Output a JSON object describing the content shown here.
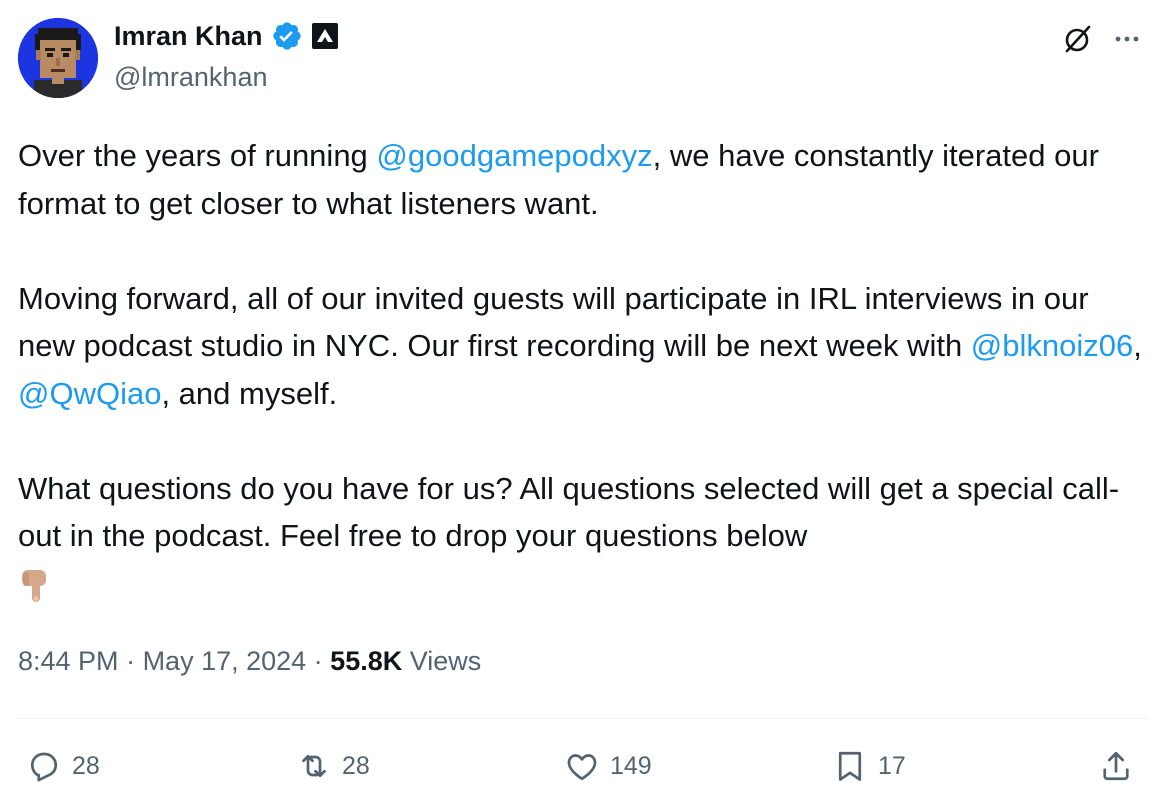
{
  "author": {
    "display_name": "Imran Khan",
    "handle": "@lmrankhan",
    "avatar_bg": "#1d35e0",
    "verified_color": "#1d9bf0",
    "icons": [
      "verified-badge-icon",
      "affiliation-badge-icon"
    ]
  },
  "header_actions": {
    "icons": [
      "grok-icon",
      "more-icon"
    ]
  },
  "tweet": {
    "p1": {
      "a": "Over the years of running ",
      "mention": "@goodgamepodxyz",
      "b": ", we have constantly iterated our format to get closer to what listeners want."
    },
    "p2": {
      "a": "Moving forward, all of our invited guests will participate in IRL interviews in our new podcast studio in NYC. Our first recording will be next week with ",
      "mention1": "@blknoiz06",
      "sep": ", ",
      "mention2": "@QwQiao",
      "b": ", and myself."
    },
    "p3": {
      "a": "What questions do you have for us? All questions selected will get a special call-out in the podcast. Feel free to drop your questions below",
      "emoji": "pointing-down-emoji"
    },
    "mention_color": "#1d9bf0"
  },
  "meta": {
    "time": "8:44 PM",
    "dot1": " · ",
    "date": "May 17, 2024",
    "dot2": " · ",
    "views_count": "55.8K",
    "views_label": " Views"
  },
  "actions": {
    "reply_count": "28",
    "repost_count": "28",
    "like_count": "149",
    "bookmark_count": "17",
    "icons": [
      "reply-icon",
      "repost-icon",
      "like-icon",
      "bookmark-icon",
      "share-icon"
    ]
  }
}
